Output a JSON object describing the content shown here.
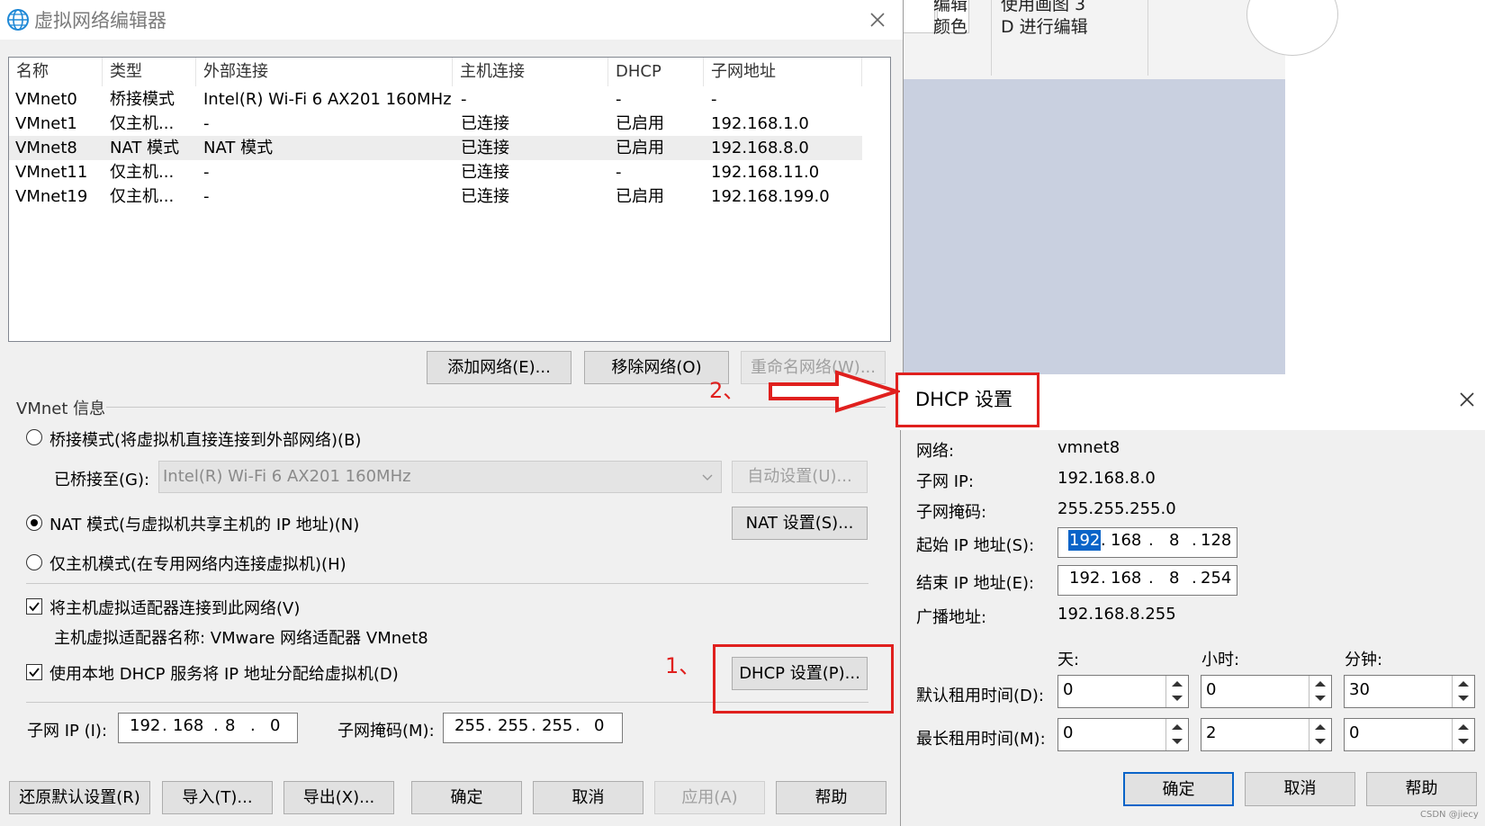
{
  "background_app": {
    "ribbon_group1_line1": "编辑",
    "ribbon_group1_line2": "颜色",
    "ribbon_group2_line1": "使用画图 3",
    "ribbon_group2_line2": "D 进行编辑"
  },
  "main": {
    "title": "虚拟网络编辑器",
    "table": {
      "headers": [
        "名称",
        "类型",
        "外部连接",
        "主机连接",
        "DHCP",
        "子网地址"
      ],
      "rows": [
        [
          "VMnet0",
          "桥接模式",
          "Intel(R) Wi-Fi 6 AX201 160MHz",
          "-",
          "-",
          "-"
        ],
        [
          "VMnet1",
          "仅主机...",
          "-",
          "已连接",
          "已启用",
          "192.168.1.0"
        ],
        [
          "VMnet8",
          "NAT 模式",
          "NAT 模式",
          "已连接",
          "已启用",
          "192.168.8.0"
        ],
        [
          "VMnet11",
          "仅主机...",
          "-",
          "已连接",
          "-",
          "192.168.11.0"
        ],
        [
          "VMnet19",
          "仅主机...",
          "-",
          "已连接",
          "已启用",
          "192.168.199.0"
        ]
      ],
      "selected_row": 2
    },
    "buttons": {
      "add_network": "添加网络(E)...",
      "remove_network": "移除网络(O)",
      "rename_network": "重命名网络(W)..."
    },
    "vmnet_info": {
      "group_label": "VMnet 信息",
      "bridge_mode": "桥接模式(将虚拟机直接连接到外部网络)(B)",
      "bridged_to_label": "已桥接至(G):",
      "bridged_to_value": "Intel(R) Wi-Fi 6 AX201 160MHz",
      "auto_settings": "自动设置(U)...",
      "nat_mode": "NAT 模式(与虚拟机共享主机的 IP 地址)(N)",
      "nat_settings": "NAT 设置(S)...",
      "host_only_mode": "仅主机模式(在专用网络内连接虚拟机)(H)",
      "connect_adapter": "将主机虚拟适配器连接到此网络(V)",
      "adapter_name": "主机虚拟适配器名称: VMware 网络适配器 VMnet8",
      "use_dhcp": "使用本地 DHCP 服务将 IP 地址分配给虚拟机(D)",
      "dhcp_settings": "DHCP 设置(P)...",
      "subnet_ip_label": "子网 IP (I):",
      "subnet_ip": [
        "192",
        "168",
        "8",
        "0"
      ],
      "subnet_mask_label": "子网掩码(M):",
      "subnet_mask": [
        "255",
        "255",
        "255",
        "0"
      ],
      "selected_mode": "nat",
      "connect_adapter_checked": true,
      "use_dhcp_checked": true
    },
    "footer_buttons": {
      "restore_defaults": "还原默认设置(R)",
      "import": "导入(T)...",
      "export": "导出(X)...",
      "ok": "确定",
      "cancel": "取消",
      "apply": "应用(A)",
      "help": "帮助"
    }
  },
  "dhcp": {
    "title": "DHCP 设置",
    "network_label": "网络:",
    "network_value": "vmnet8",
    "subnet_ip_label": "子网 IP:",
    "subnet_ip_value": "192.168.8.0",
    "subnet_mask_label": "子网掩码:",
    "subnet_mask_value": "255.255.255.0",
    "start_ip_label": "起始 IP 地址(S):",
    "start_ip": [
      "192",
      "168",
      "8",
      "128"
    ],
    "end_ip_label": "结束 IP 地址(E):",
    "end_ip": [
      "192",
      "168",
      "8",
      "254"
    ],
    "broadcast_label": "广播地址:",
    "broadcast_value": "192.168.8.255",
    "col_days": "天:",
    "col_hours": "小时:",
    "col_minutes": "分钟:",
    "default_lease_label": "默认租用时间(D):",
    "default_lease": [
      "0",
      "0",
      "30"
    ],
    "max_lease_label": "最长租用时间(M):",
    "max_lease": [
      "0",
      "2",
      "0"
    ],
    "ok": "确定",
    "cancel": "取消",
    "help": "帮助"
  },
  "annotations": {
    "step1": "1、",
    "step2": "2、",
    "color": "#e0201e"
  },
  "watermark": "CSDN @jiecy"
}
